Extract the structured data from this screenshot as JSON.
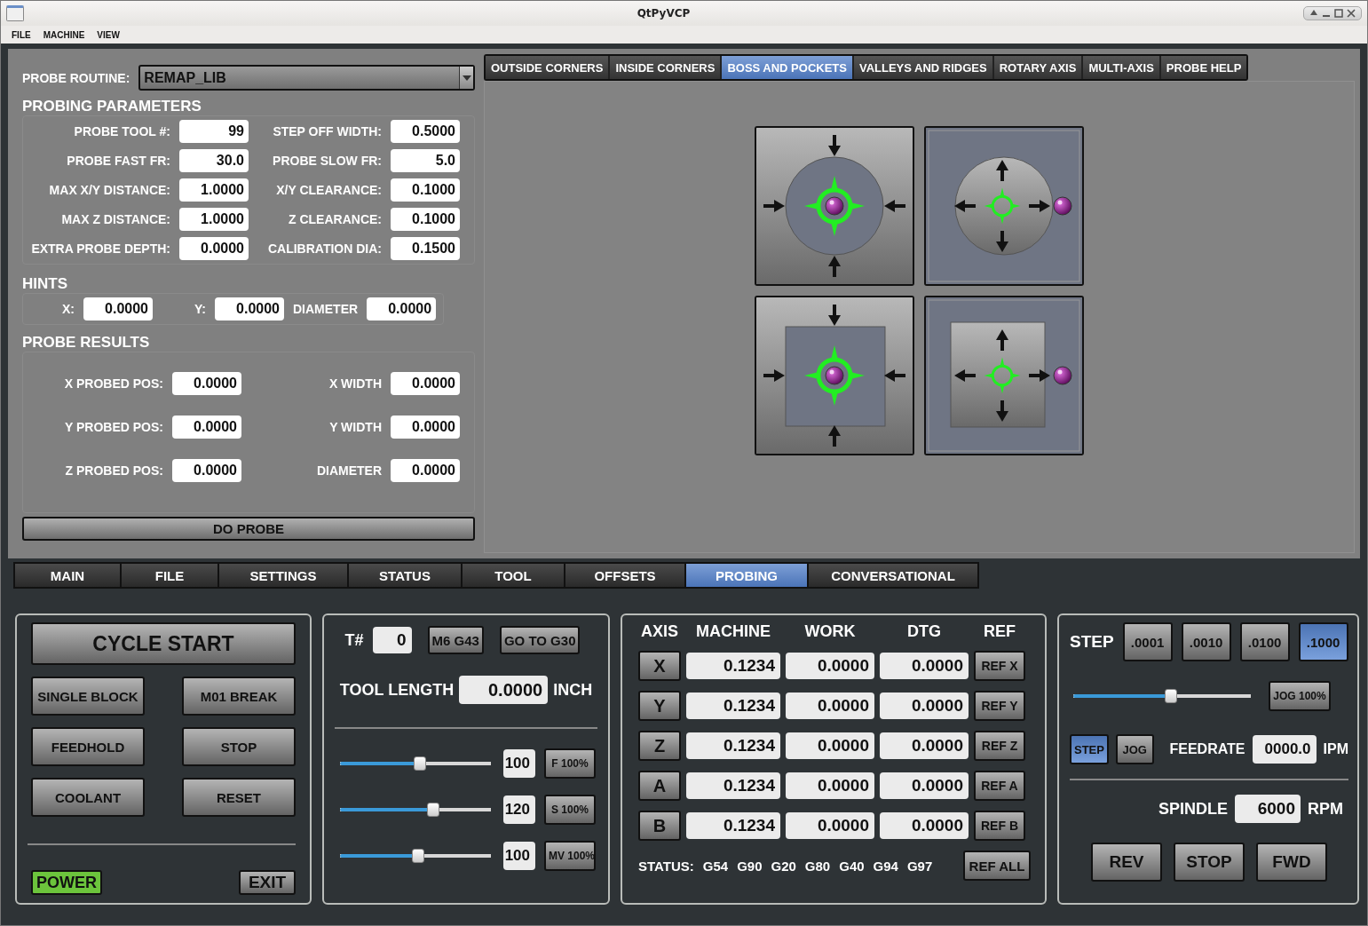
{
  "window": {
    "title": "QtPyVCP"
  },
  "menu": [
    {
      "label": "FILE"
    },
    {
      "label": "MACHINE"
    },
    {
      "label": "VIEW"
    }
  ],
  "probe_routine": {
    "label": "PROBE ROUTINE:",
    "value": "REMAP_LIB"
  },
  "probing_parameters": {
    "title": "PROBING PARAMETERS",
    "fields": [
      {
        "label": "PROBE TOOL #:",
        "value": "99"
      },
      {
        "label": "STEP OFF WIDTH:",
        "value": "0.5000"
      },
      {
        "label": "PROBE FAST FR:",
        "value": "30.0"
      },
      {
        "label": "PROBE SLOW FR:",
        "value": "5.0"
      },
      {
        "label": "MAX X/Y DISTANCE:",
        "value": "1.0000"
      },
      {
        "label": "X/Y CLEARANCE:",
        "value": "0.1000"
      },
      {
        "label": "MAX Z DISTANCE:",
        "value": "1.0000"
      },
      {
        "label": "Z CLEARANCE:",
        "value": "0.1000"
      },
      {
        "label": "EXTRA PROBE DEPTH:",
        "value": "0.0000"
      },
      {
        "label": "CALIBRATION DIA:",
        "value": "0.1500"
      }
    ]
  },
  "hints": {
    "title": "HINTS",
    "fields": [
      {
        "label": "X:",
        "value": "0.0000"
      },
      {
        "label": "Y:",
        "value": "0.0000"
      },
      {
        "label": "DIAMETER",
        "value": "0.0000"
      }
    ]
  },
  "probe_results": {
    "title": "PROBE RESULTS",
    "fields": [
      {
        "label": "X PROBED POS:",
        "value": "0.0000"
      },
      {
        "label": "X WIDTH",
        "value": "0.0000"
      },
      {
        "label": "Y PROBED POS:",
        "value": "0.0000"
      },
      {
        "label": "Y WIDTH",
        "value": "0.0000"
      },
      {
        "label": "Z PROBED POS:",
        "value": "0.0000"
      },
      {
        "label": "DIAMETER",
        "value": "0.0000"
      }
    ]
  },
  "do_probe": {
    "label": "DO PROBE"
  },
  "probe_tabs": [
    {
      "label": "OUTSIDE CORNERS",
      "selected": false
    },
    {
      "label": "INSIDE CORNERS",
      "selected": false
    },
    {
      "label": "BOSS AND POCKETS",
      "selected": true
    },
    {
      "label": "VALLEYS AND RIDGES",
      "selected": false
    },
    {
      "label": "ROTARY AXIS",
      "selected": false
    },
    {
      "label": "MULTI-AXIS",
      "selected": false
    },
    {
      "label": "PROBE HELP",
      "selected": false
    }
  ],
  "probe_diagrams": [
    {
      "kind": "round_boss"
    },
    {
      "kind": "round_pocket"
    },
    {
      "kind": "square_boss"
    },
    {
      "kind": "square_pocket"
    }
  ],
  "main_tabs": [
    {
      "label": "MAIN",
      "selected": false
    },
    {
      "label": "FILE",
      "selected": false
    },
    {
      "label": "SETTINGS",
      "selected": false
    },
    {
      "label": "STATUS",
      "selected": false
    },
    {
      "label": "TOOL",
      "selected": false
    },
    {
      "label": "OFFSETS",
      "selected": false
    },
    {
      "label": "PROBING",
      "selected": true
    },
    {
      "label": "CONVERSATIONAL",
      "selected": false
    }
  ],
  "machine_controls": {
    "cycle_start": "CYCLE START",
    "buttons": [
      "SINGLE BLOCK",
      "M01 BREAK",
      "FEEDHOLD",
      "STOP",
      "COOLANT",
      "RESET"
    ],
    "power": {
      "label": "POWER",
      "on": true
    },
    "exit": "EXIT"
  },
  "tool": {
    "number_label": "T#",
    "number": "0",
    "buttons": [
      "M6 G43",
      "GO TO G30"
    ],
    "length_label": "TOOL LENGTH",
    "length": "0.0000",
    "unit": "INCH",
    "overrides": [
      {
        "level": 0.53,
        "value": "100",
        "button": "F 100%"
      },
      {
        "level": 0.62,
        "value": "120",
        "button": "S 100%"
      },
      {
        "level": 0.52,
        "value": "100",
        "button": "MV 100%"
      }
    ]
  },
  "dro": {
    "headers": [
      "AXIS",
      "MACHINE",
      "WORK",
      "DTG",
      "REF"
    ],
    "rows": [
      {
        "axis": "X",
        "machine": "0.1234",
        "work": "0.0000",
        "dtg": "0.0000",
        "ref": "REF X"
      },
      {
        "axis": "Y",
        "machine": "0.1234",
        "work": "0.0000",
        "dtg": "0.0000",
        "ref": "REF Y"
      },
      {
        "axis": "Z",
        "machine": "0.1234",
        "work": "0.0000",
        "dtg": "0.0000",
        "ref": "REF Z"
      },
      {
        "axis": "A",
        "machine": "0.1234",
        "work": "0.0000",
        "dtg": "0.0000",
        "ref": "REF A"
      },
      {
        "axis": "B",
        "machine": "0.1234",
        "work": "0.0000",
        "dtg": "0.0000",
        "ref": "REF B"
      }
    ],
    "status_label": "STATUS:",
    "status_codes": [
      "G54",
      "G90",
      "G20",
      "G80",
      "G40",
      "G94",
      "G97"
    ],
    "ref_all": "REF ALL"
  },
  "jog": {
    "step_label": "STEP",
    "steps": [
      {
        "label": ".0001",
        "selected": false
      },
      {
        "label": ".0010",
        "selected": false
      },
      {
        "label": ".0100",
        "selected": false
      },
      {
        "label": ".1000",
        "selected": true
      }
    ],
    "level": 0.55,
    "jog_button": "JOG 100%",
    "modes": [
      {
        "label": "STEP",
        "selected": true
      },
      {
        "label": "JOG",
        "selected": false
      }
    ],
    "feedrate": {
      "label": "FEEDRATE",
      "value": "0000.0",
      "unit": "IPM"
    },
    "spindle": {
      "label": "SPINDLE",
      "value": "6000",
      "unit": "RPM"
    },
    "spindle_buttons": [
      "REV",
      "STOP",
      "FWD"
    ]
  }
}
